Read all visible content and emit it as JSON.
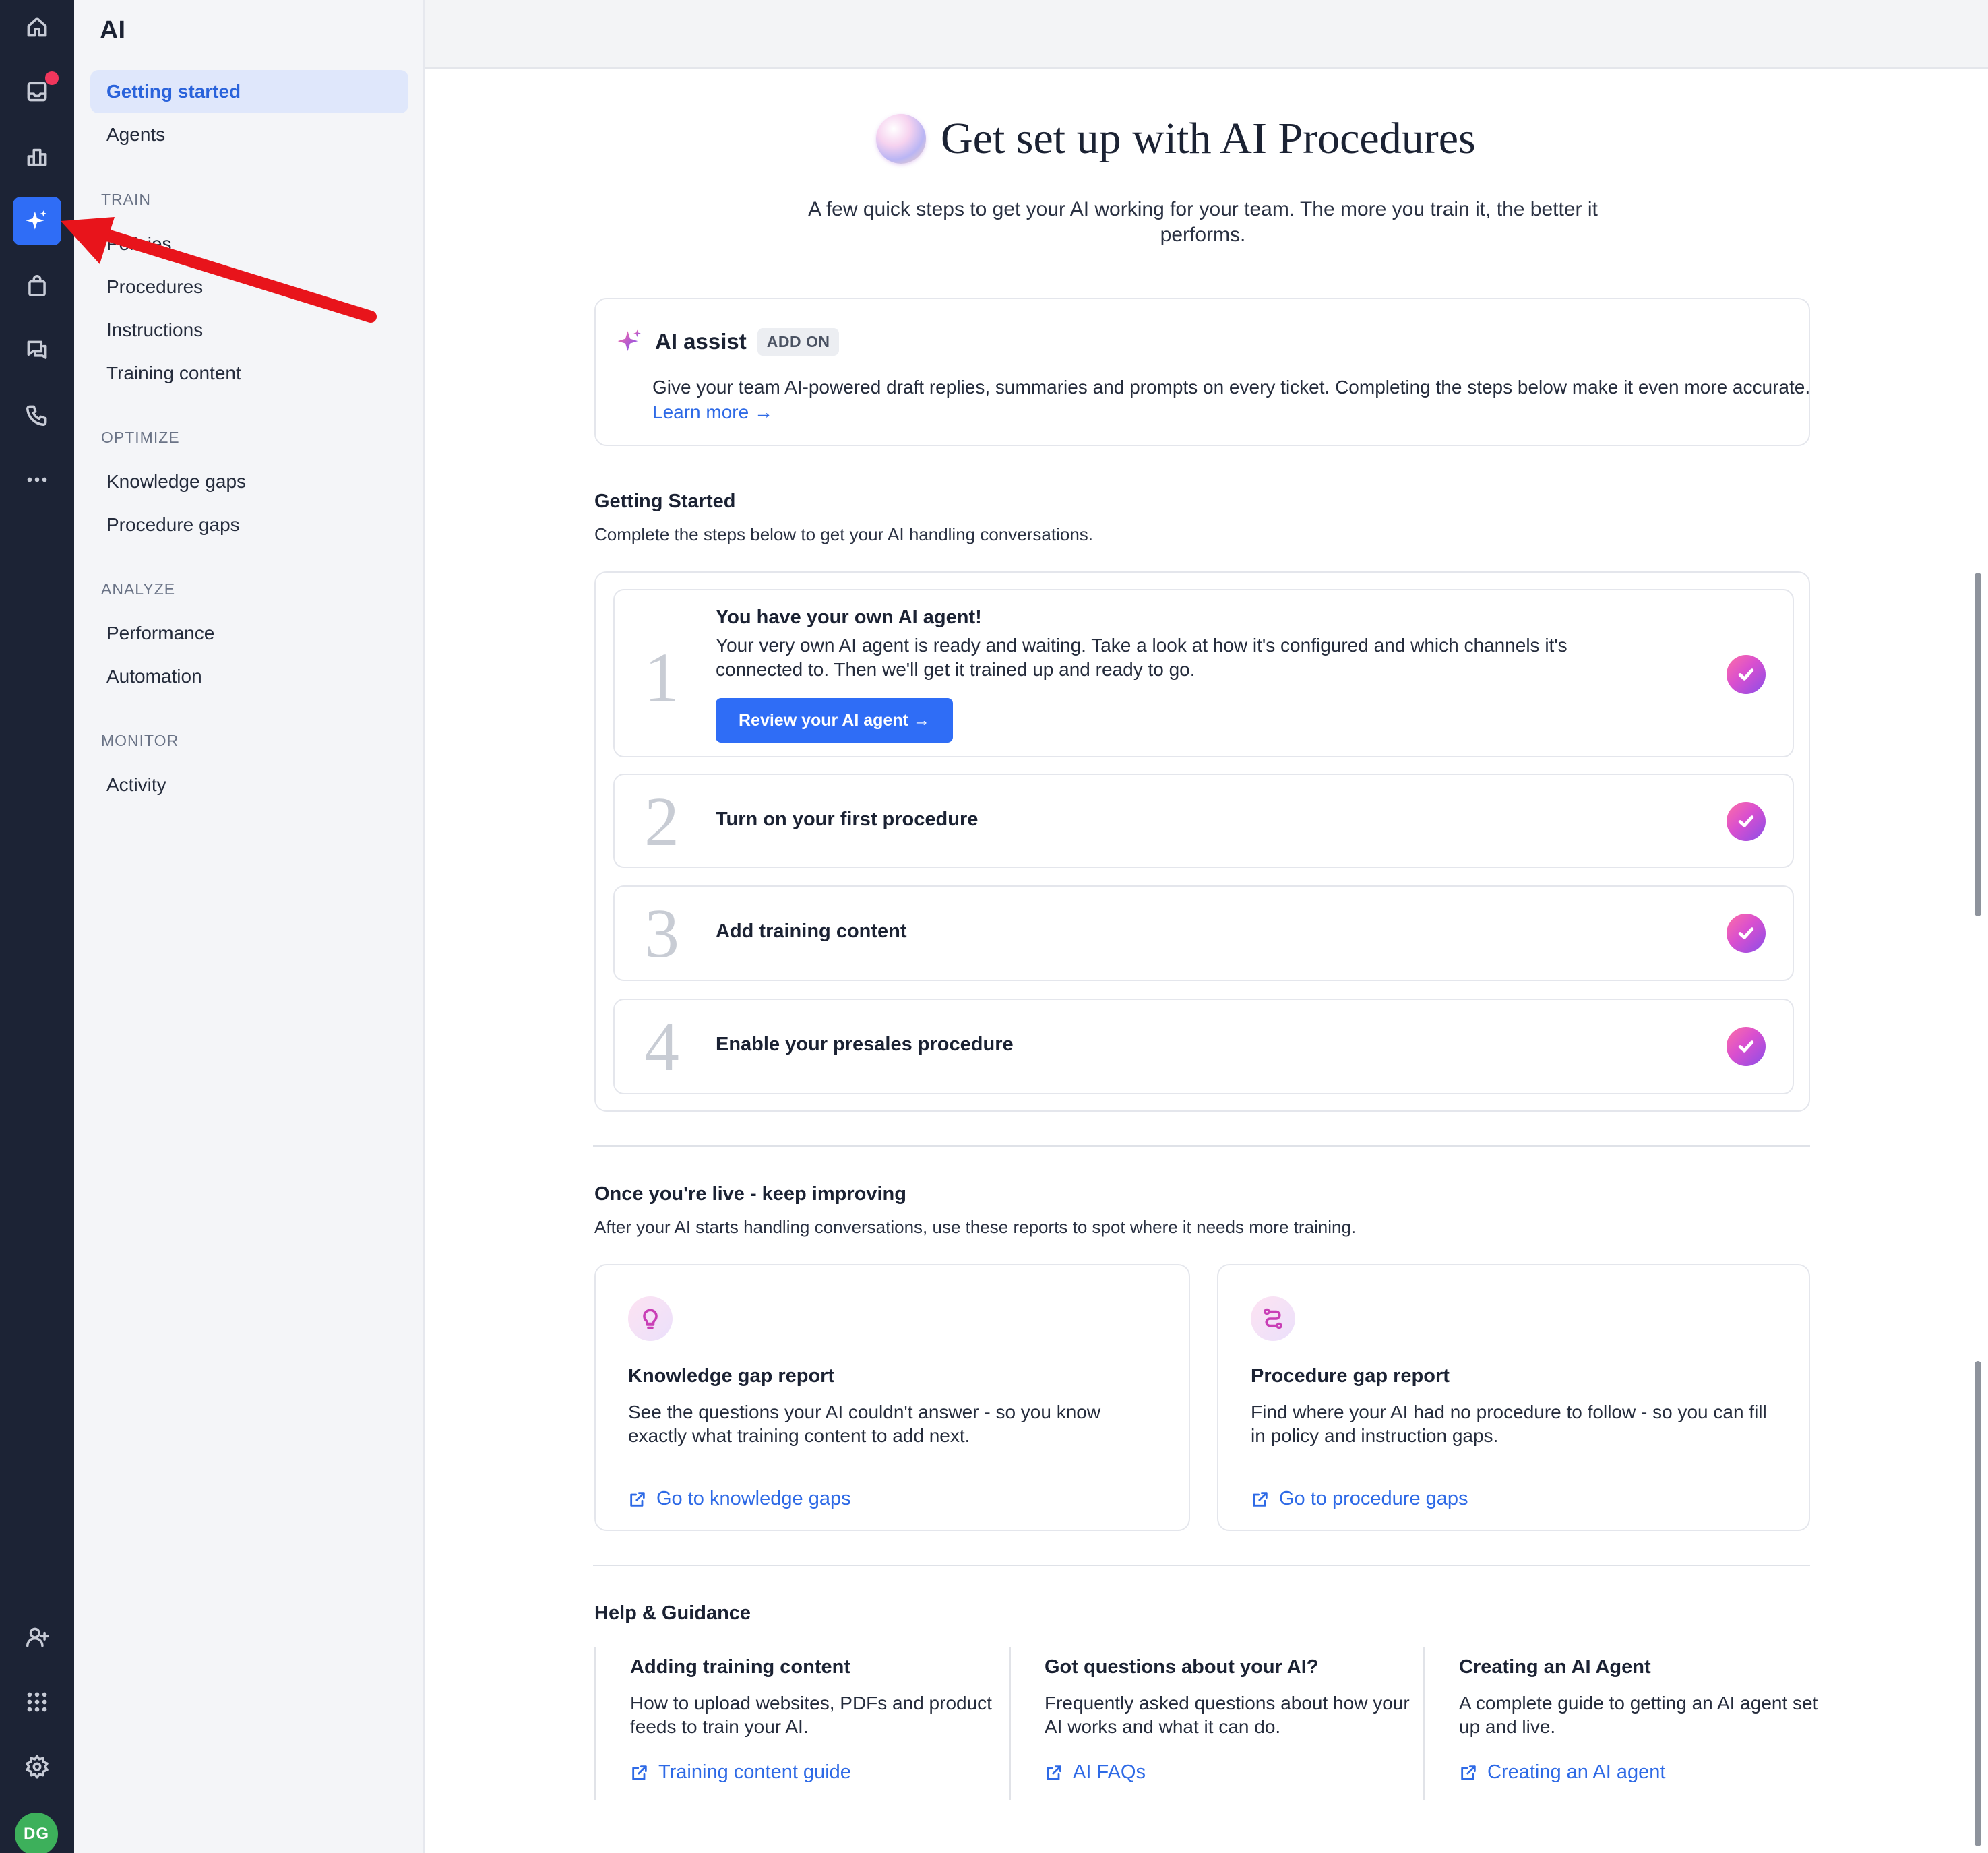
{
  "sidebar": {
    "title": "AI",
    "items_top": [
      {
        "label": "Getting started",
        "active": true
      },
      {
        "label": "Agents",
        "active": false
      }
    ],
    "sections": [
      {
        "heading": "TRAIN",
        "items": [
          "Policies",
          "Procedures",
          "Instructions",
          "Training content"
        ]
      },
      {
        "heading": "OPTIMIZE",
        "items": [
          "Knowledge gaps",
          "Procedure gaps"
        ]
      },
      {
        "heading": "ANALYZE",
        "items": [
          "Performance",
          "Automation"
        ]
      },
      {
        "heading": "MONITOR",
        "items": [
          "Activity"
        ]
      }
    ]
  },
  "rail": {
    "icons": [
      "home-icon",
      "inbox-icon",
      "analytics-icon",
      "ai-sparkle-icon",
      "shopping-bag-icon",
      "chat-icon",
      "phone-icon",
      "more-icon",
      "add-user-icon",
      "apps-grid-icon",
      "settings-icon"
    ],
    "avatar_initials": "DG",
    "accent": "#2f6df6",
    "notification_color": "#f0365c"
  },
  "hero": {
    "title": "Get set up with AI Procedures",
    "subtitle": "A few quick steps to get your AI working for your team. The more you train it, the better it performs."
  },
  "assist": {
    "title": "AI assist",
    "badge": "ADD ON",
    "body": "Give your team AI-powered draft replies, summaries and prompts on every ticket. Completing the steps below make it even more accurate.",
    "link": "Learn more →"
  },
  "getting_started": {
    "title": "Getting Started",
    "description": "Complete the steps below to get your AI handling conversations.",
    "steps": [
      {
        "number": "1",
        "title": "You have your own AI agent!",
        "description": "Your very own AI agent is ready and waiting. Take a look at how it's configured and which channels it's connected to. Then we'll get it trained up and ready to go.",
        "button": "Review your AI agent →",
        "done": true
      },
      {
        "number": "2",
        "title": "Turn on your first procedure",
        "done": true
      },
      {
        "number": "3",
        "title": "Add training content",
        "done": true
      },
      {
        "number": "4",
        "title": "Enable your presales procedure",
        "done": true
      }
    ]
  },
  "improve": {
    "title": "Once you're live - keep improving",
    "description": "After your AI starts handling conversations, use these reports to spot where it needs more training.",
    "reports": [
      {
        "icon": "lightbulb-icon",
        "title": "Knowledge gap report",
        "description": "See the questions your AI couldn't answer - so you know exactly what training content to add next.",
        "link": "Go to knowledge gaps"
      },
      {
        "icon": "route-icon",
        "title": "Procedure gap report",
        "description": "Find where your AI had no procedure to follow - so you can fill in policy and instruction gaps.",
        "link": "Go to procedure gaps"
      }
    ]
  },
  "help": {
    "title": "Help & Guidance",
    "items": [
      {
        "title": "Adding training content",
        "description": "How to upload websites, PDFs and product feeds to train your AI.",
        "link": "Training content guide"
      },
      {
        "title": "Got questions about your AI?",
        "description": "Frequently asked questions about how your AI works and what it can do.",
        "link": "AI FAQs"
      },
      {
        "title": "Creating an AI Agent",
        "description": "A complete guide to getting an AI agent set up and live.",
        "link": "Creating an AI agent"
      }
    ]
  }
}
